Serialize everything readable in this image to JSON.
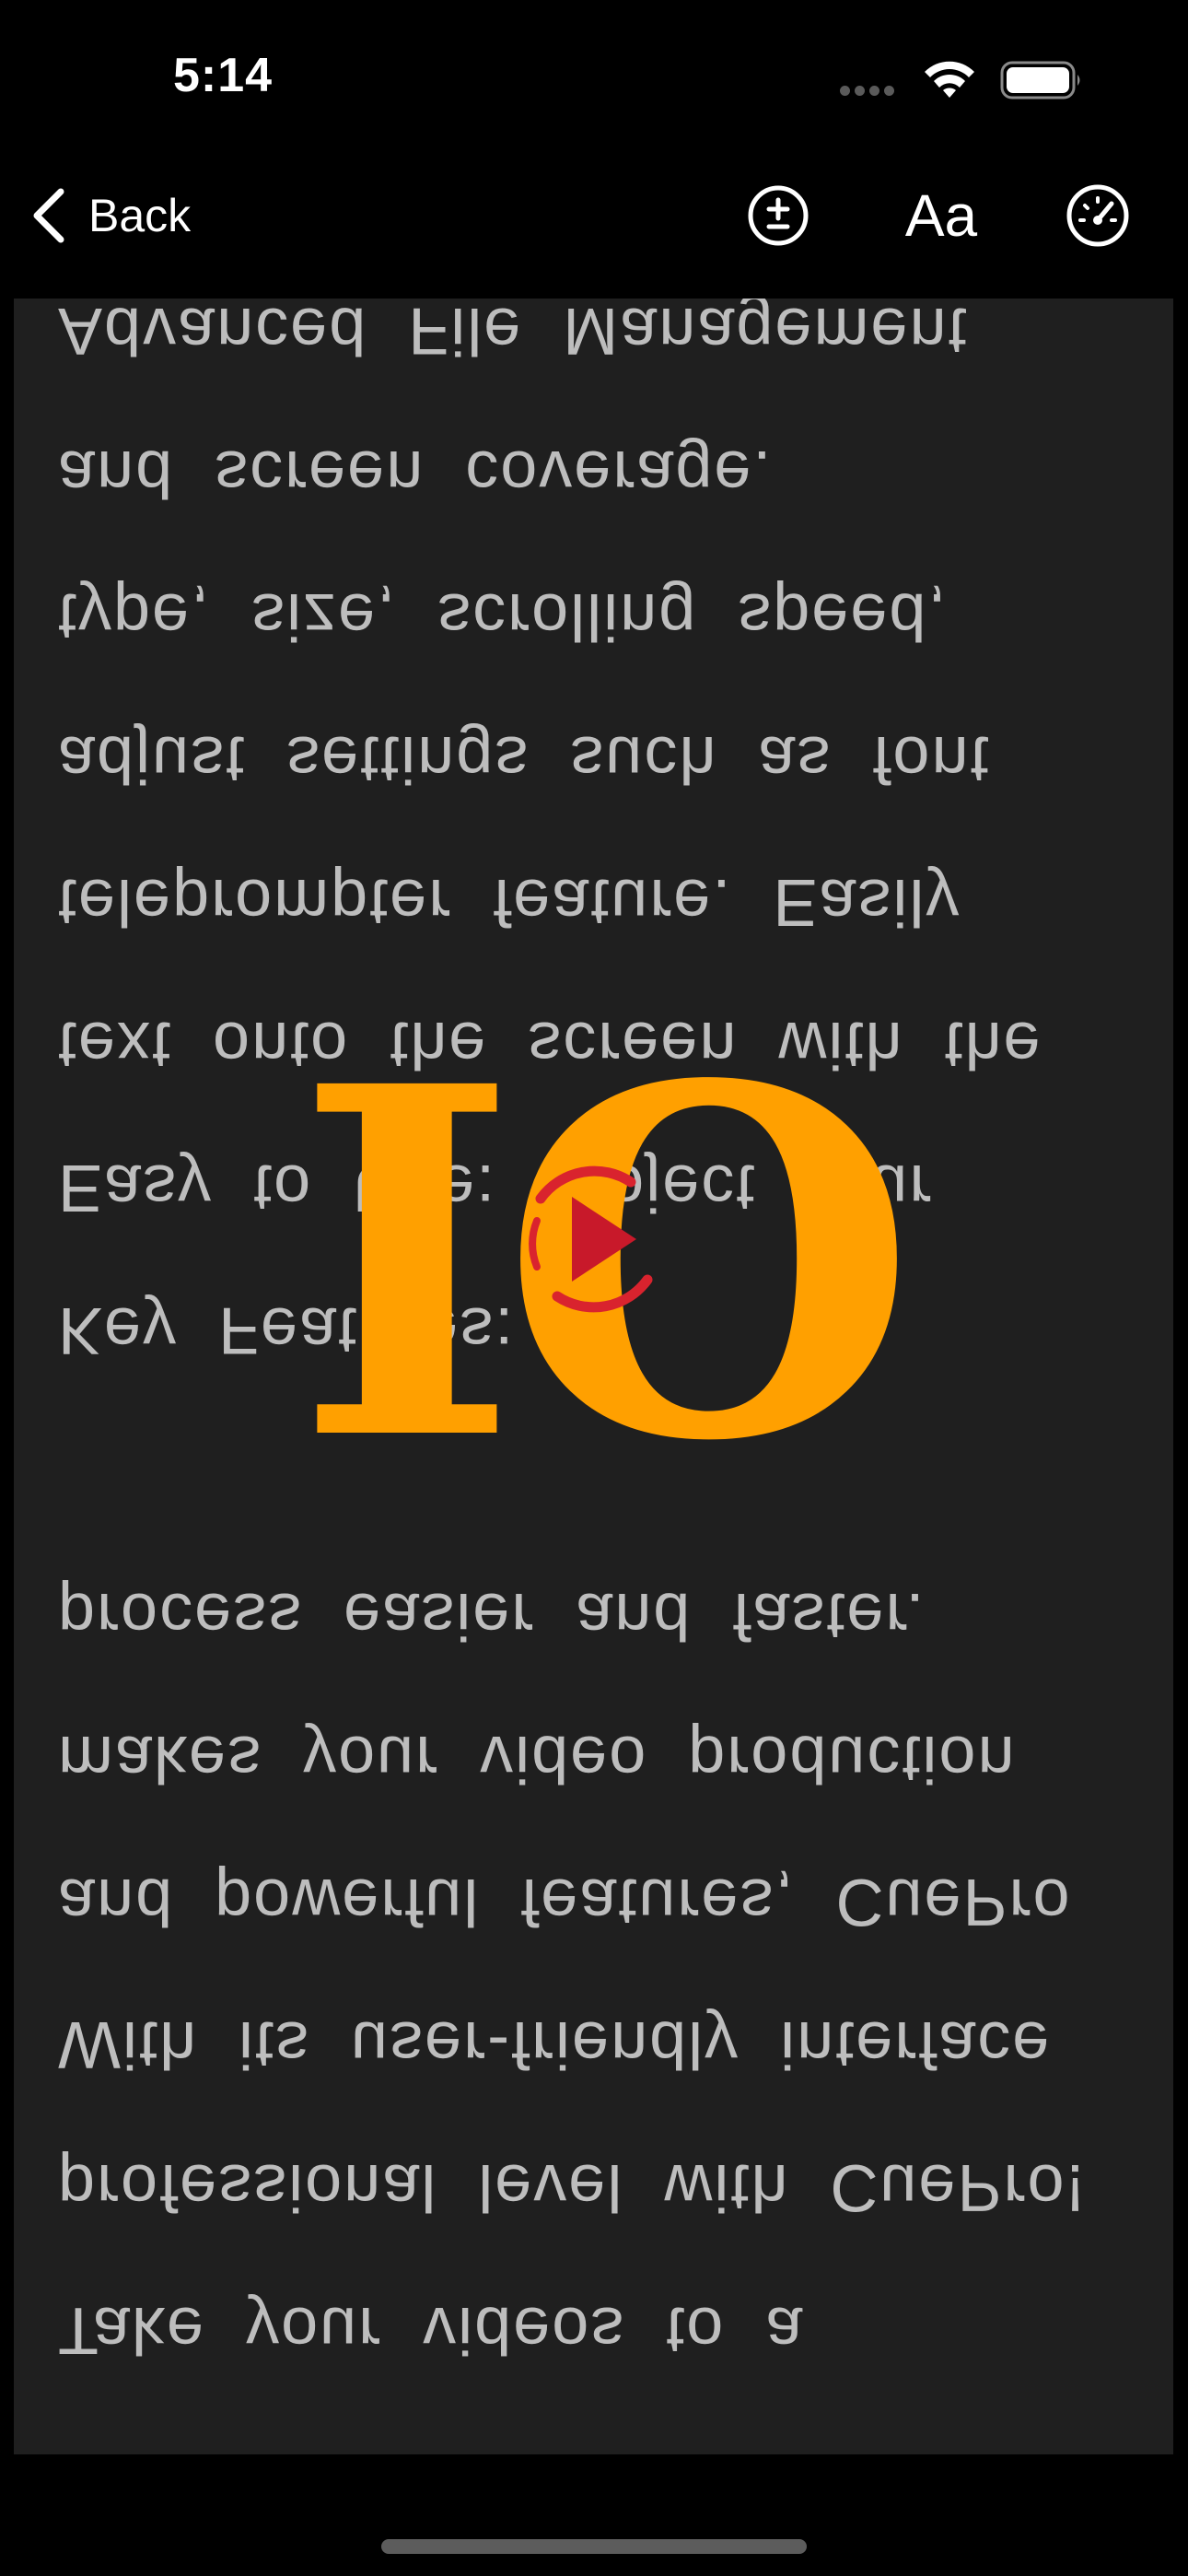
{
  "status_bar": {
    "time": "5:14"
  },
  "nav": {
    "back_label": "Back",
    "font_label": "Aa",
    "icons": [
      "chevron-left-icon",
      "plus-minus-circle-icon",
      "speedometer-icon"
    ]
  },
  "prompter": {
    "mirrored": true,
    "lines": [
      "Take your videos to a",
      "professional level with CuePro!",
      "With its user-friendly interface",
      "and powerful features, CuePro",
      "makes your video production",
      "process easier and faster.",
      "",
      "Key Features:",
      "Easy to Use: Project your",
      "text onto the screen with the",
      "teleprompter feature. Easily",
      "adjust settings such as font",
      "type, size, scrolling speed,",
      "and screen coverage.",
      "Advanced File Management"
    ]
  },
  "logo": {
    "text": "IO",
    "colors": {
      "letters": "#FFA000",
      "play_icon": "#D9232E"
    }
  },
  "colors": {
    "background": "#000000",
    "panel": "#1F1F1F",
    "text": "#BDBDBD"
  }
}
